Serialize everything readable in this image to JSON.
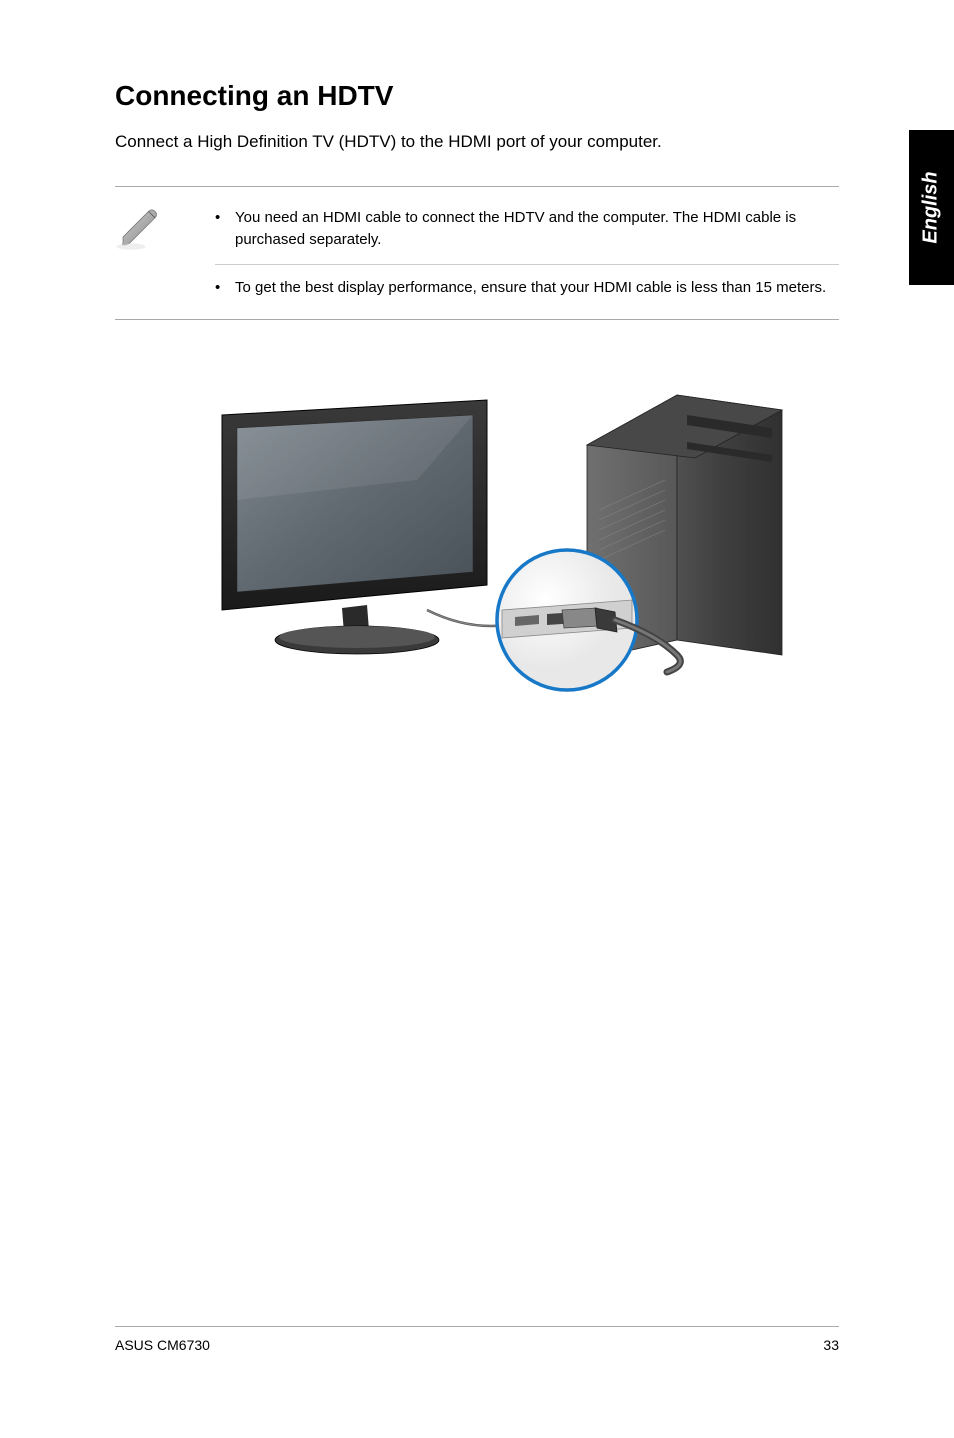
{
  "heading": "Connecting an HDTV",
  "intro": "Connect a High Definition TV (HDTV) to the HDMI port of your computer.",
  "notes": {
    "item1": "You need an HDMI cable to connect the HDTV and the computer. The HDMI cable is purchased separately.",
    "item2": "To get the best display performance, ensure that your HDMI cable is less than 15 meters."
  },
  "bullet": "•",
  "sideTab": "English",
  "footer": {
    "left": "ASUS CM6730",
    "right": "33"
  }
}
